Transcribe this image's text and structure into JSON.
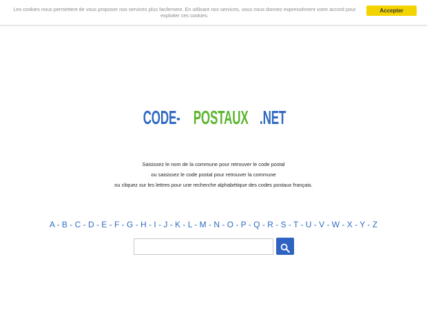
{
  "cookie": {
    "text": "Les cookies nous permettent de vous proposer nos services plus facilement. En utilisant nos services, vous nous donnez expressément votre accord pour exploiter ces cookies.",
    "accept_label": "Accepter"
  },
  "logo": {
    "part1": "CODE-",
    "part2": "POSTAUX",
    "part3": ".NET"
  },
  "colors": {
    "blue": "#2f68c2",
    "green": "#5ab52f",
    "accept_yellow": "#f3d400"
  },
  "intro": {
    "line1": "Saisissez le nom de la commune pour retrouver le code postal",
    "line2": "ou saisissez le code postal pour retrouver la commune",
    "line3": "ou cliquez sur les lettres pour une recherche alphabétique des codes postaux français."
  },
  "alphabet": [
    "A",
    "B",
    "C",
    "D",
    "E",
    "F",
    "G",
    "H",
    "I",
    "J",
    "K",
    "L",
    "M",
    "N",
    "O",
    "P",
    "Q",
    "R",
    "S",
    "T",
    "U",
    "V",
    "W",
    "X",
    "Y",
    "Z"
  ],
  "search": {
    "value": "",
    "icon": "search-icon"
  }
}
